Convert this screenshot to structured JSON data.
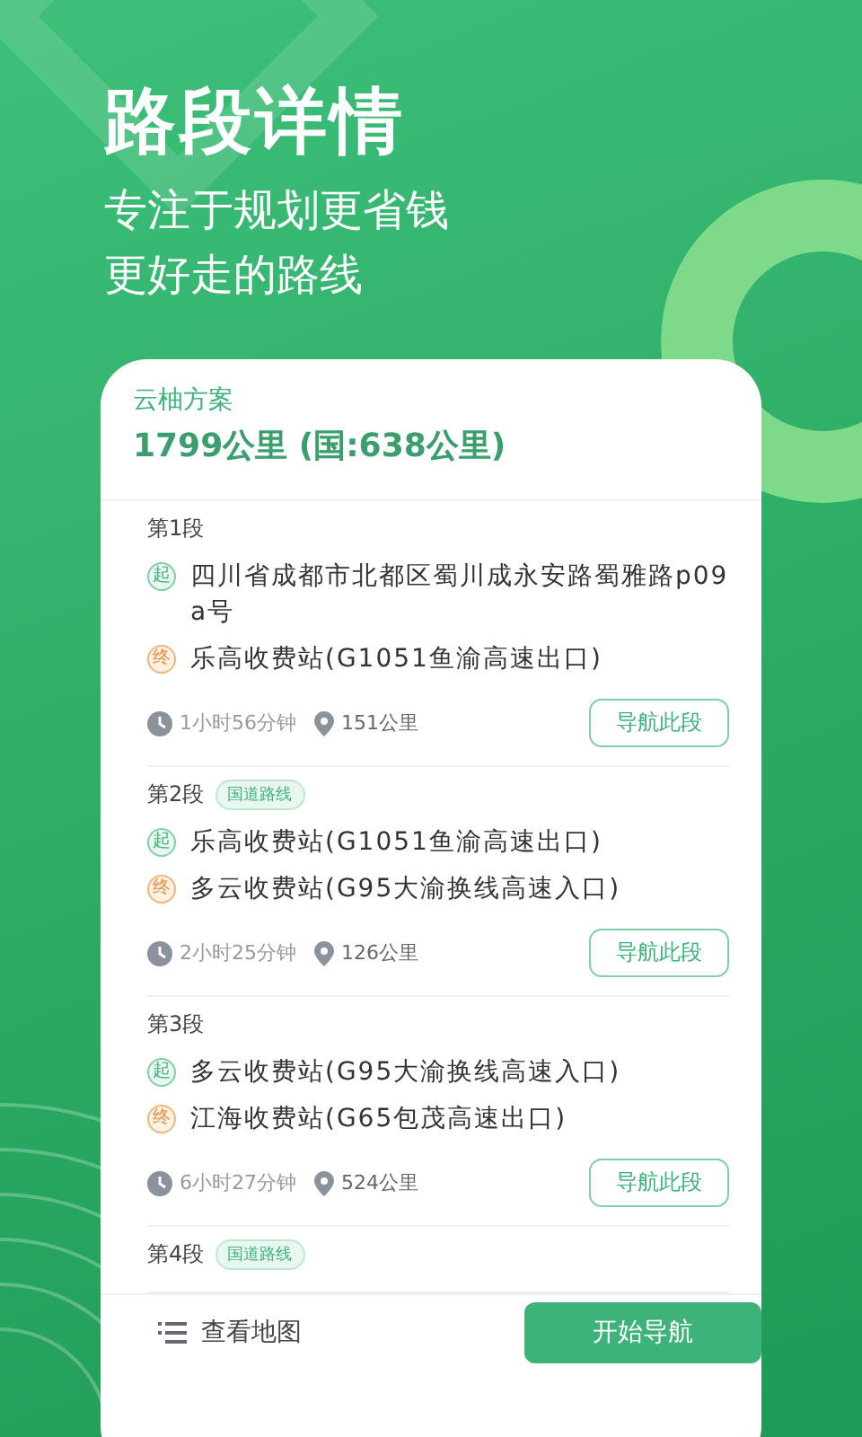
{
  "headline": "路段详情",
  "subtitle_lines": [
    "专注于规划更省钱",
    "更好走的路线"
  ],
  "plan": {
    "name": "云柚方案",
    "summary": "1799公里 (国:638公里)"
  },
  "segments": [
    {
      "label": "第1段",
      "start_mark": "起",
      "start": "四川省成都市北都区蜀川成永安路蜀雅路p09a号",
      "end_mark": "终",
      "end": "乐高收费站(G1051鱼渝高速出口)",
      "time": "1小时56分钟",
      "distance": "151公里",
      "button": "导航此段"
    },
    {
      "label": "第2段",
      "tag": "国道路线",
      "start_mark": "起",
      "start": "乐高收费站(G1051鱼渝高速出口)",
      "end_mark": "终",
      "end": "多云收费站(G95大渝换线高速入口)",
      "time": "2小时25分钟",
      "distance": "126公里",
      "button": "导航此段"
    },
    {
      "label": "第3段",
      "start_mark": "起",
      "start": "多云收费站(G95大渝换线高速入口)",
      "end_mark": "终",
      "end": "江海收费站(G65包茂高速出口)",
      "time": "6小时27分钟",
      "distance": "524公里",
      "button": "导航此段"
    },
    {
      "label": "第4段",
      "tag": "国道路线"
    }
  ],
  "bottom_bar": {
    "map_link": "查看地图",
    "start_button": "开始导航"
  }
}
